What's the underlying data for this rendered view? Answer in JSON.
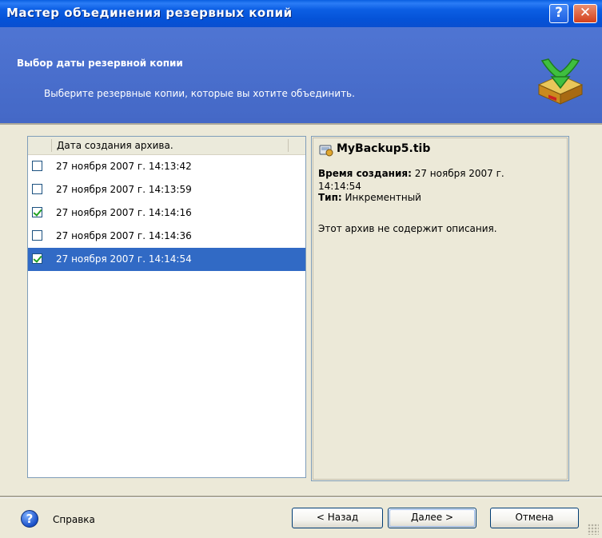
{
  "window": {
    "title": "Мастер объединения резервных копий",
    "help_button": "?",
    "close_button": "✕"
  },
  "header": {
    "title": "Выбор даты резервной копии",
    "subtitle": "Выберите резервные копии, которые вы хотите объединить."
  },
  "list": {
    "column_header": "Дата создания архива.",
    "items": [
      {
        "label": "27 ноября 2007 г. 14:13:42",
        "checked": false,
        "selected": false
      },
      {
        "label": "27 ноября 2007 г. 14:13:59",
        "checked": false,
        "selected": false
      },
      {
        "label": "27 ноября 2007 г. 14:14:16",
        "checked": true,
        "selected": false
      },
      {
        "label": "27 ноября 2007 г. 14:14:36",
        "checked": false,
        "selected": false
      },
      {
        "label": "27 ноября 2007 г. 14:14:54",
        "checked": true,
        "selected": true
      }
    ]
  },
  "details": {
    "file_name": "MyBackup5.tib",
    "created_label": "Время создания:",
    "created_value": "27 ноября 2007 г.",
    "created_value_2": "14:14:54",
    "type_label": "Тип:",
    "type_value": "Инкрементный",
    "description": "Этот архив не содержит описания."
  },
  "footer": {
    "help_label": "Справка",
    "back_label": "< Назад",
    "next_label": "Далее >",
    "cancel_label": "Отмена"
  },
  "colors": {
    "title_bar": "#0a5fe0",
    "header_band": "#4a6fcd",
    "selection": "#316ac5",
    "window_bg": "#ece9d8"
  }
}
